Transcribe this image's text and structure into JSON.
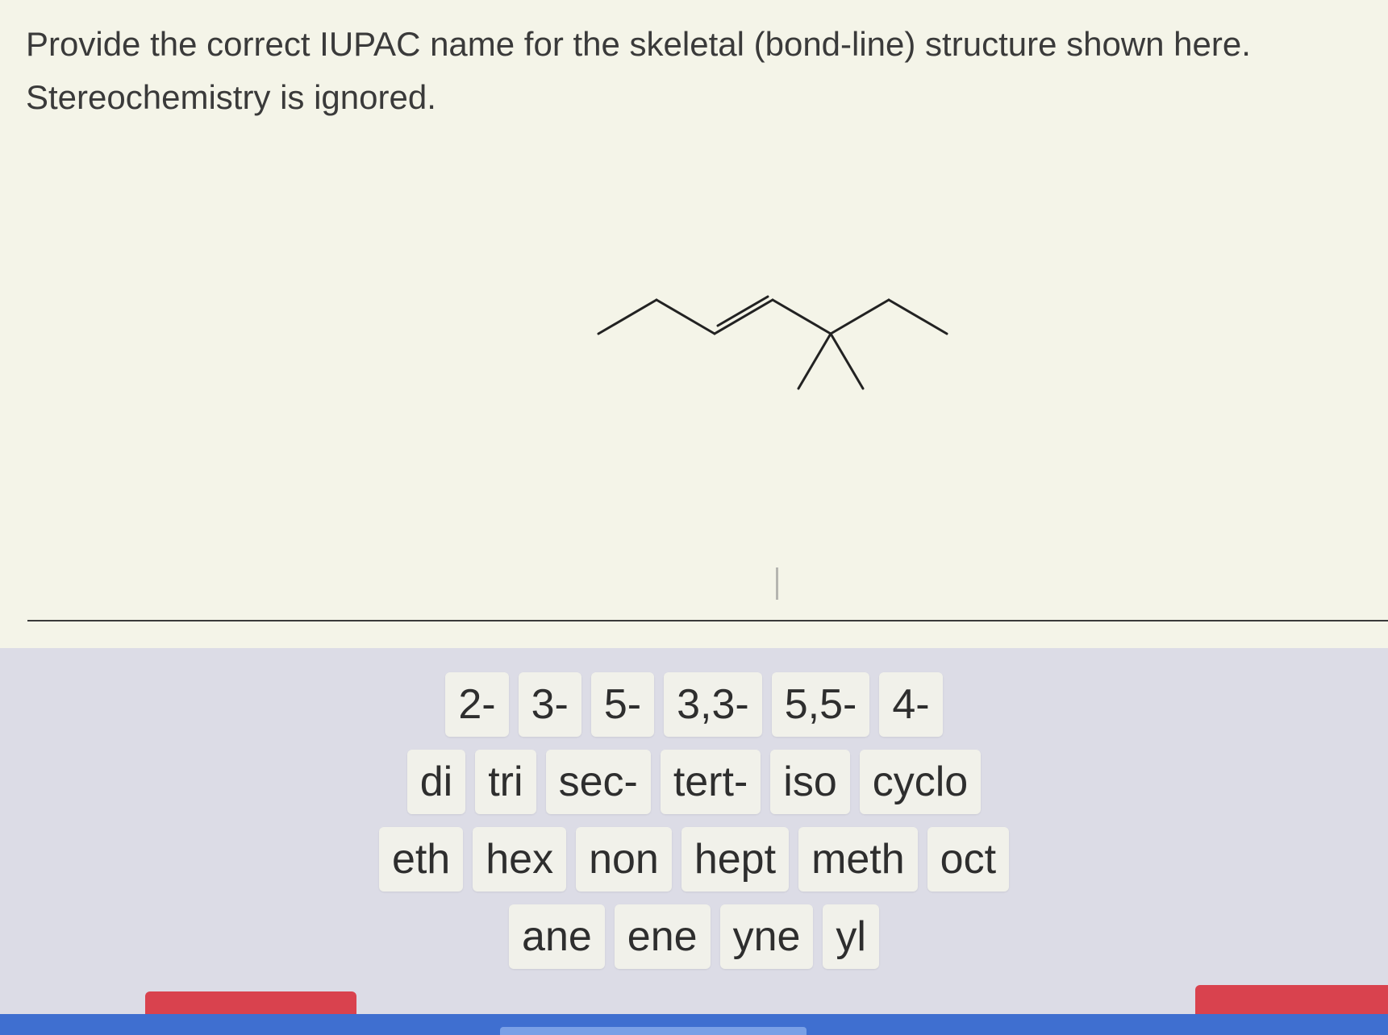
{
  "question": {
    "line1": "Provide the correct IUPAC name for the skeletal (bond-line) structure shown here.",
    "line2": "Stereochemistry is ignored."
  },
  "palette": {
    "rows": [
      [
        "2-",
        "3-",
        "5-",
        "3,3-",
        "5,5-",
        "4-"
      ],
      [
        "di",
        "tri",
        "sec-",
        "tert-",
        "iso",
        "cyclo"
      ],
      [
        "eth",
        "hex",
        "non",
        "hept",
        "meth",
        "oct"
      ],
      [
        "ane",
        "ene",
        "yne",
        "yl"
      ]
    ]
  },
  "colors": {
    "page_bg": "#f4f4e8",
    "palette_bg": "#dcdce6",
    "tile_bg": "#f1f1ea",
    "button_red": "#d9424e",
    "taskbar_blue": "#3f6fd0"
  }
}
